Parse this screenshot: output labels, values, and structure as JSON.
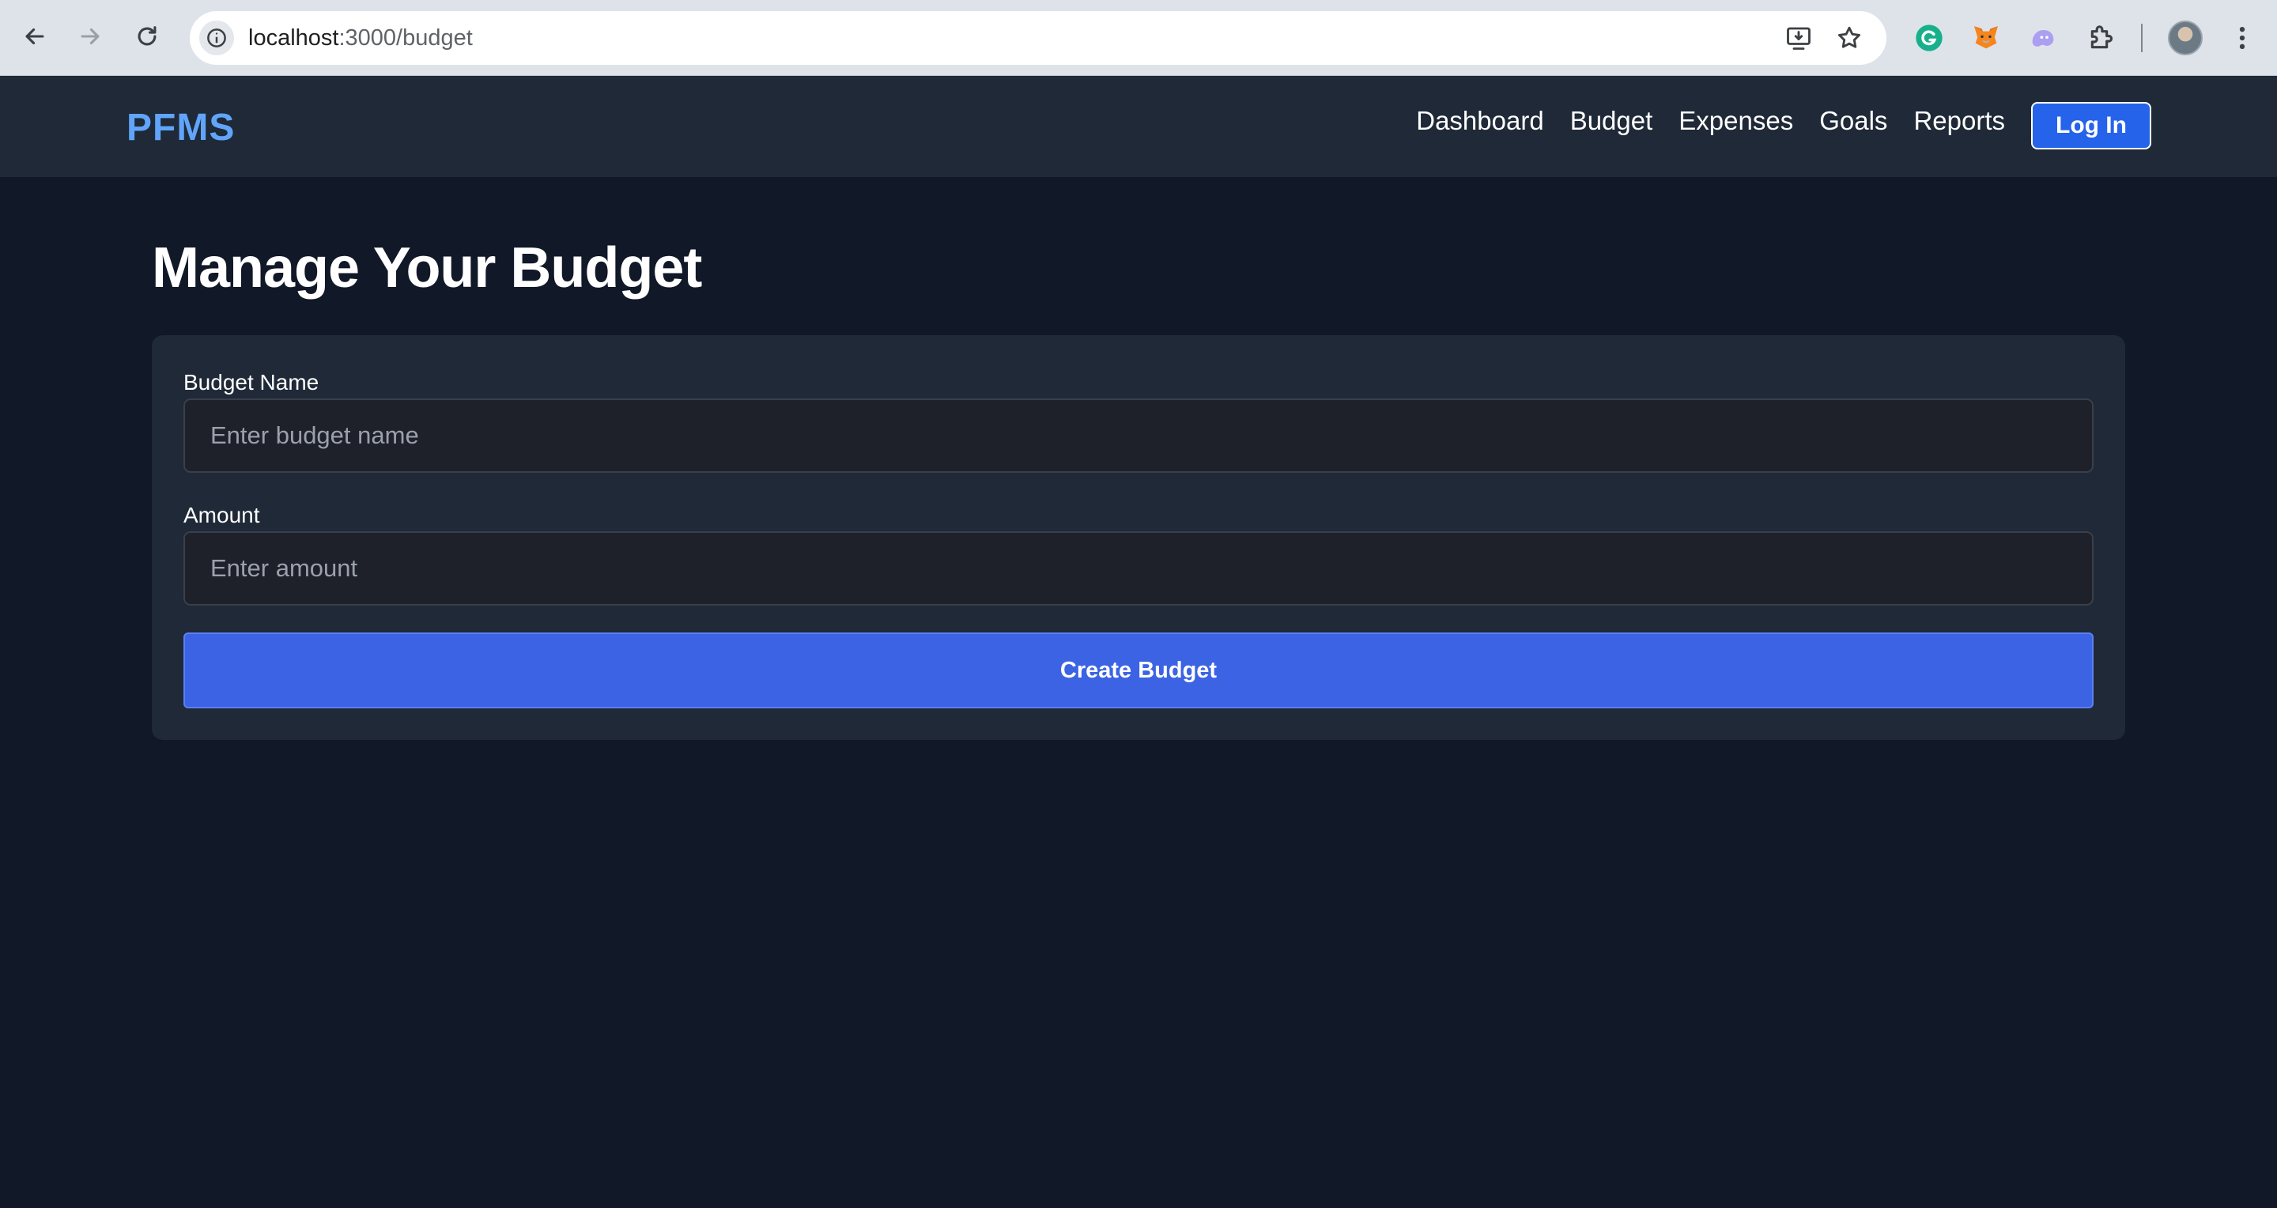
{
  "browser": {
    "url_host": "localhost",
    "url_path": ":3000/budget"
  },
  "navbar": {
    "brand": "PFMS",
    "links": [
      "Dashboard",
      "Budget",
      "Expenses",
      "Goals",
      "Reports"
    ],
    "login_label": "Log In"
  },
  "main": {
    "title": "Manage Your Budget",
    "form": {
      "budget_name_label": "Budget Name",
      "budget_name_placeholder": "Enter budget name",
      "budget_name_value": "",
      "amount_label": "Amount",
      "amount_placeholder": "Enter amount",
      "amount_value": "",
      "submit_label": "Create Budget"
    }
  },
  "colors": {
    "page_background": "#111827",
    "navbar_background": "#1f2937",
    "card_background": "#1f2937",
    "brand": "#60a5fa",
    "primary_button": "#3b63e3",
    "login_button": "#2563eb"
  },
  "icons": {
    "browser": [
      "back-icon",
      "forward-icon",
      "reload-icon",
      "site-info-icon",
      "install-app-icon",
      "bookmark-star-icon"
    ],
    "extensions": [
      "grammarly-icon",
      "metamask-icon",
      "ghost-extension-icon",
      "extensions-puzzle-icon"
    ],
    "profile": "profile-avatar",
    "menu": "kebab-menu-icon"
  }
}
